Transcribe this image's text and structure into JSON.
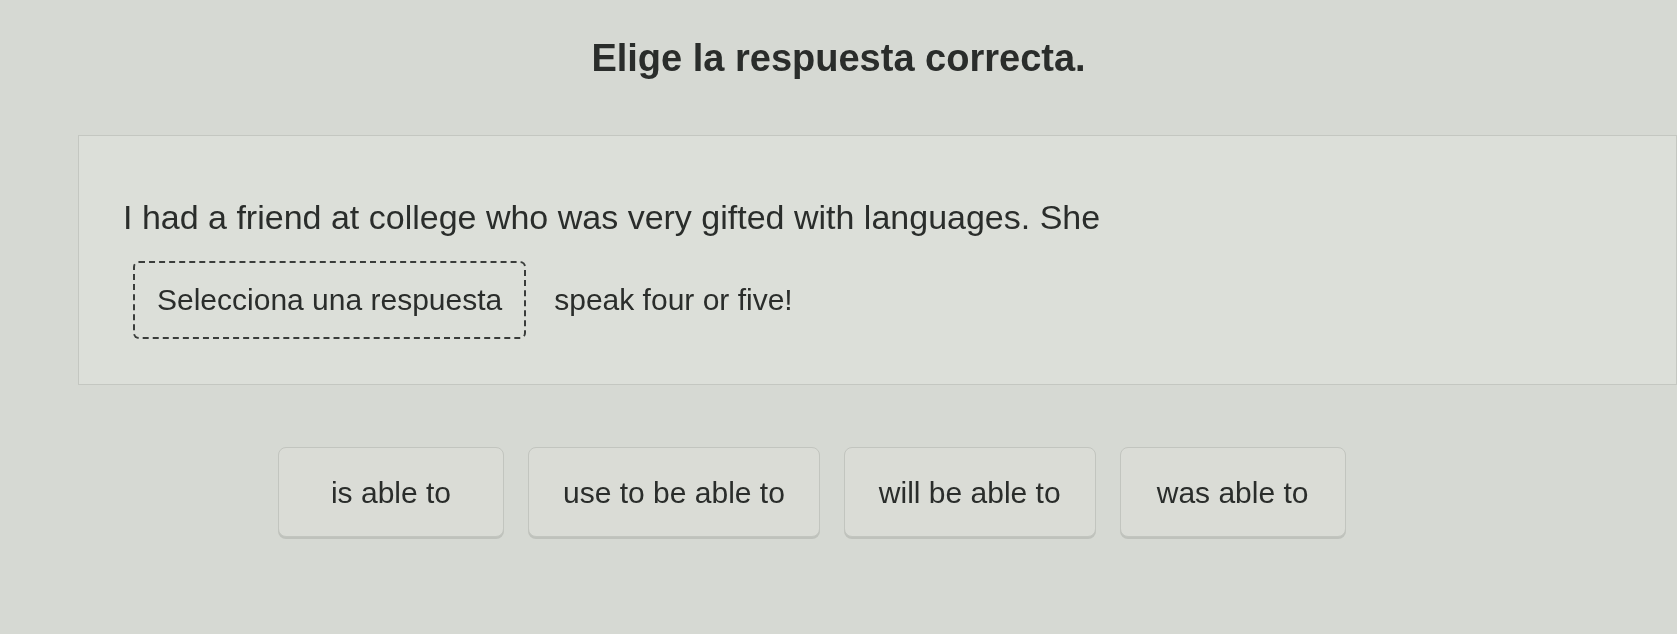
{
  "instruction": "Elige la respuesta correcta.",
  "question": {
    "text_before": "I had a friend at college who was very gifted with languages. She",
    "blank": {
      "placeholder": "Selecciona una respuesta"
    },
    "text_after": "speak four or five!"
  },
  "options": [
    "is able to",
    "use to be able to",
    "will be able to",
    "was able to"
  ]
}
